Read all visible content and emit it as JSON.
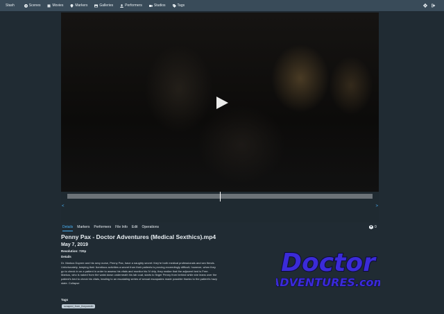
{
  "nav": {
    "brand": "Stash",
    "items": [
      {
        "label": "Scenes",
        "icon": "play-circle-icon"
      },
      {
        "label": "Movies",
        "icon": "film-icon"
      },
      {
        "label": "Markers",
        "icon": "map-marker-icon"
      },
      {
        "label": "Galleries",
        "icon": "image-icon"
      },
      {
        "label": "Performers",
        "icon": "user-icon"
      },
      {
        "label": "Studios",
        "icon": "video-icon"
      },
      {
        "label": "Tags",
        "icon": "tag-icon"
      }
    ],
    "right_icons": [
      "gear-icon",
      "sign-out-icon"
    ]
  },
  "player": {
    "play_icon": "play-icon",
    "scrubber": {
      "position": 0.5,
      "left_arrow": "<",
      "right_arrow": ">"
    }
  },
  "tabs": [
    {
      "label": "Details",
      "active": true
    },
    {
      "label": "Markers",
      "active": false
    },
    {
      "label": "Performers",
      "active": false
    },
    {
      "label": "File Info",
      "active": false
    },
    {
      "label": "Edit",
      "active": false
    },
    {
      "label": "Operations",
      "active": false
    }
  ],
  "organized": {
    "count": "0",
    "icon": "box-icon"
  },
  "scene": {
    "title": "Penny Pax - Doctor Adventures (Medical Sexthics).mp4",
    "date": "May 7, 2019",
    "resolution": "Resolution: 720p",
    "details_heading": "Details",
    "details": "Dr. Markus Dupree and his sexy nurse, Penny Pax, have a naughty secret: they're both medical professionals and sex fiends. Unfortunately, keeping their licentious activities a secret from their patients is proving exceedingly difficult; however, when they go to check in on a patient in order to assess his vitals and monitor his IV drip, they realize that the adjacent bed is Free. Markus, who is naked from the waist down underneath his lab coat, starts to finger Penny from behind while she leans over the patient's bed to check his vitals, leading to an escalating series of sexual escapades made possible thanks to the patient's hazy state. Collapse",
    "tags_heading": "Tags",
    "tags": [
      "scraped_from_theporndb"
    ]
  },
  "studio": {
    "logo_line1": "Doctor",
    "logo_line2": "ADVENTURES.com",
    "colors": {
      "fill": "#3b2bd8",
      "outline": "#0d0a3a",
      "accent": "#ffffff"
    }
  },
  "colors": {
    "background": "#202b33",
    "navbar": "#394b59",
    "accent": "#48aff0"
  }
}
